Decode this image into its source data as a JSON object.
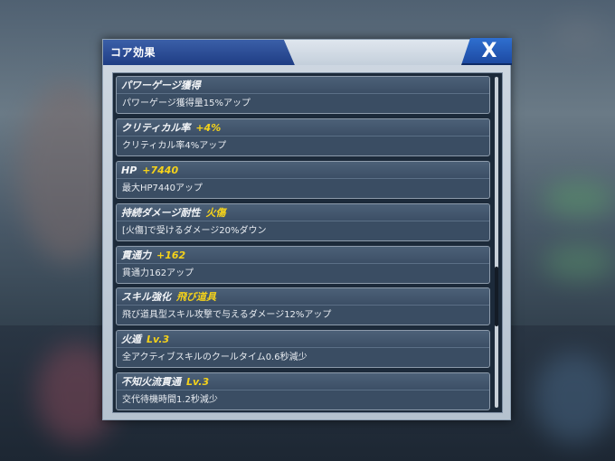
{
  "dialog": {
    "title": "コア効果",
    "close_label": "X"
  },
  "items": [
    {
      "name": "パワーゲージ獲得",
      "highlight": "",
      "desc": "パワーゲージ獲得量15%アップ"
    },
    {
      "name": "クリティカル率",
      "highlight": "+4%",
      "desc": "クリティカル率4%アップ"
    },
    {
      "name": "HP",
      "highlight": "+7440",
      "desc": "最大HP7440アップ"
    },
    {
      "name": "持続ダメージ耐性",
      "highlight": "火傷",
      "desc": "[火傷]で受けるダメージ20%ダウン"
    },
    {
      "name": "貫通力",
      "highlight": "+162",
      "desc": "貫通力162アップ"
    },
    {
      "name": "スキル強化",
      "highlight": "飛び道具",
      "desc": "飛び道具型スキル攻撃で与えるダメージ12%アップ"
    },
    {
      "name": "火遁",
      "highlight": "Lv.3",
      "desc": "全アクティブスキルのクールタイム0.6秒減少"
    },
    {
      "name": "不知火流貫通",
      "highlight": "Lv.3",
      "desc": "交代待機時間1.2秒減少"
    }
  ],
  "colors": {
    "highlight": "#f5d21a",
    "title_bar": "#1f3d84",
    "close_button": "#2f6fd0"
  }
}
